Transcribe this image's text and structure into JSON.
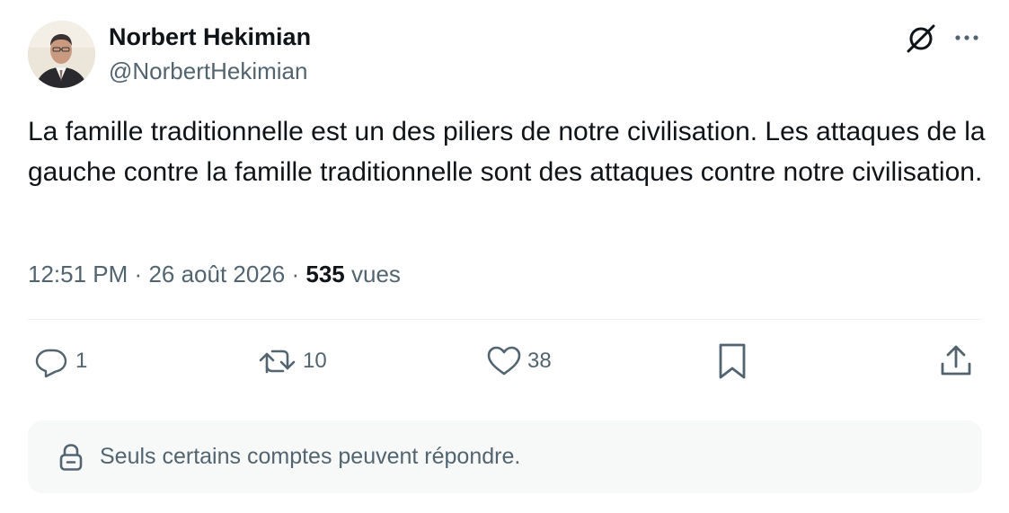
{
  "author": {
    "name": "Norbert Hekimian",
    "handle": "@NorbertHekimian",
    "avatar_icon": "avatar-photo"
  },
  "header_icons": [
    "grok-icon",
    "more-icon"
  ],
  "tweet": {
    "text": "La famille traditionnelle est un des piliers de notre civilisation. Les attaques de la gauche contre la famille traditionnelle sont des attaques contre notre civilisation."
  },
  "meta": {
    "time": "12:51 PM",
    "separator": "·",
    "date": "26 août 2026",
    "views_count": "535",
    "views_label": "vues"
  },
  "actions": {
    "reply": {
      "icon": "reply-icon",
      "count": "1"
    },
    "retweet": {
      "icon": "retweet-icon",
      "count": "10"
    },
    "like": {
      "icon": "heart-icon",
      "count": "38"
    },
    "bookmark": {
      "icon": "bookmark-icon"
    },
    "share": {
      "icon": "share-icon"
    }
  },
  "reply_restriction": {
    "icon": "lock-icon",
    "text": "Seuls certains comptes peuvent répondre."
  },
  "colors": {
    "primary_text": "#0f1419",
    "secondary_text": "#536471",
    "divider": "#eff3f4",
    "notice_bg": "#f7f9f9"
  }
}
